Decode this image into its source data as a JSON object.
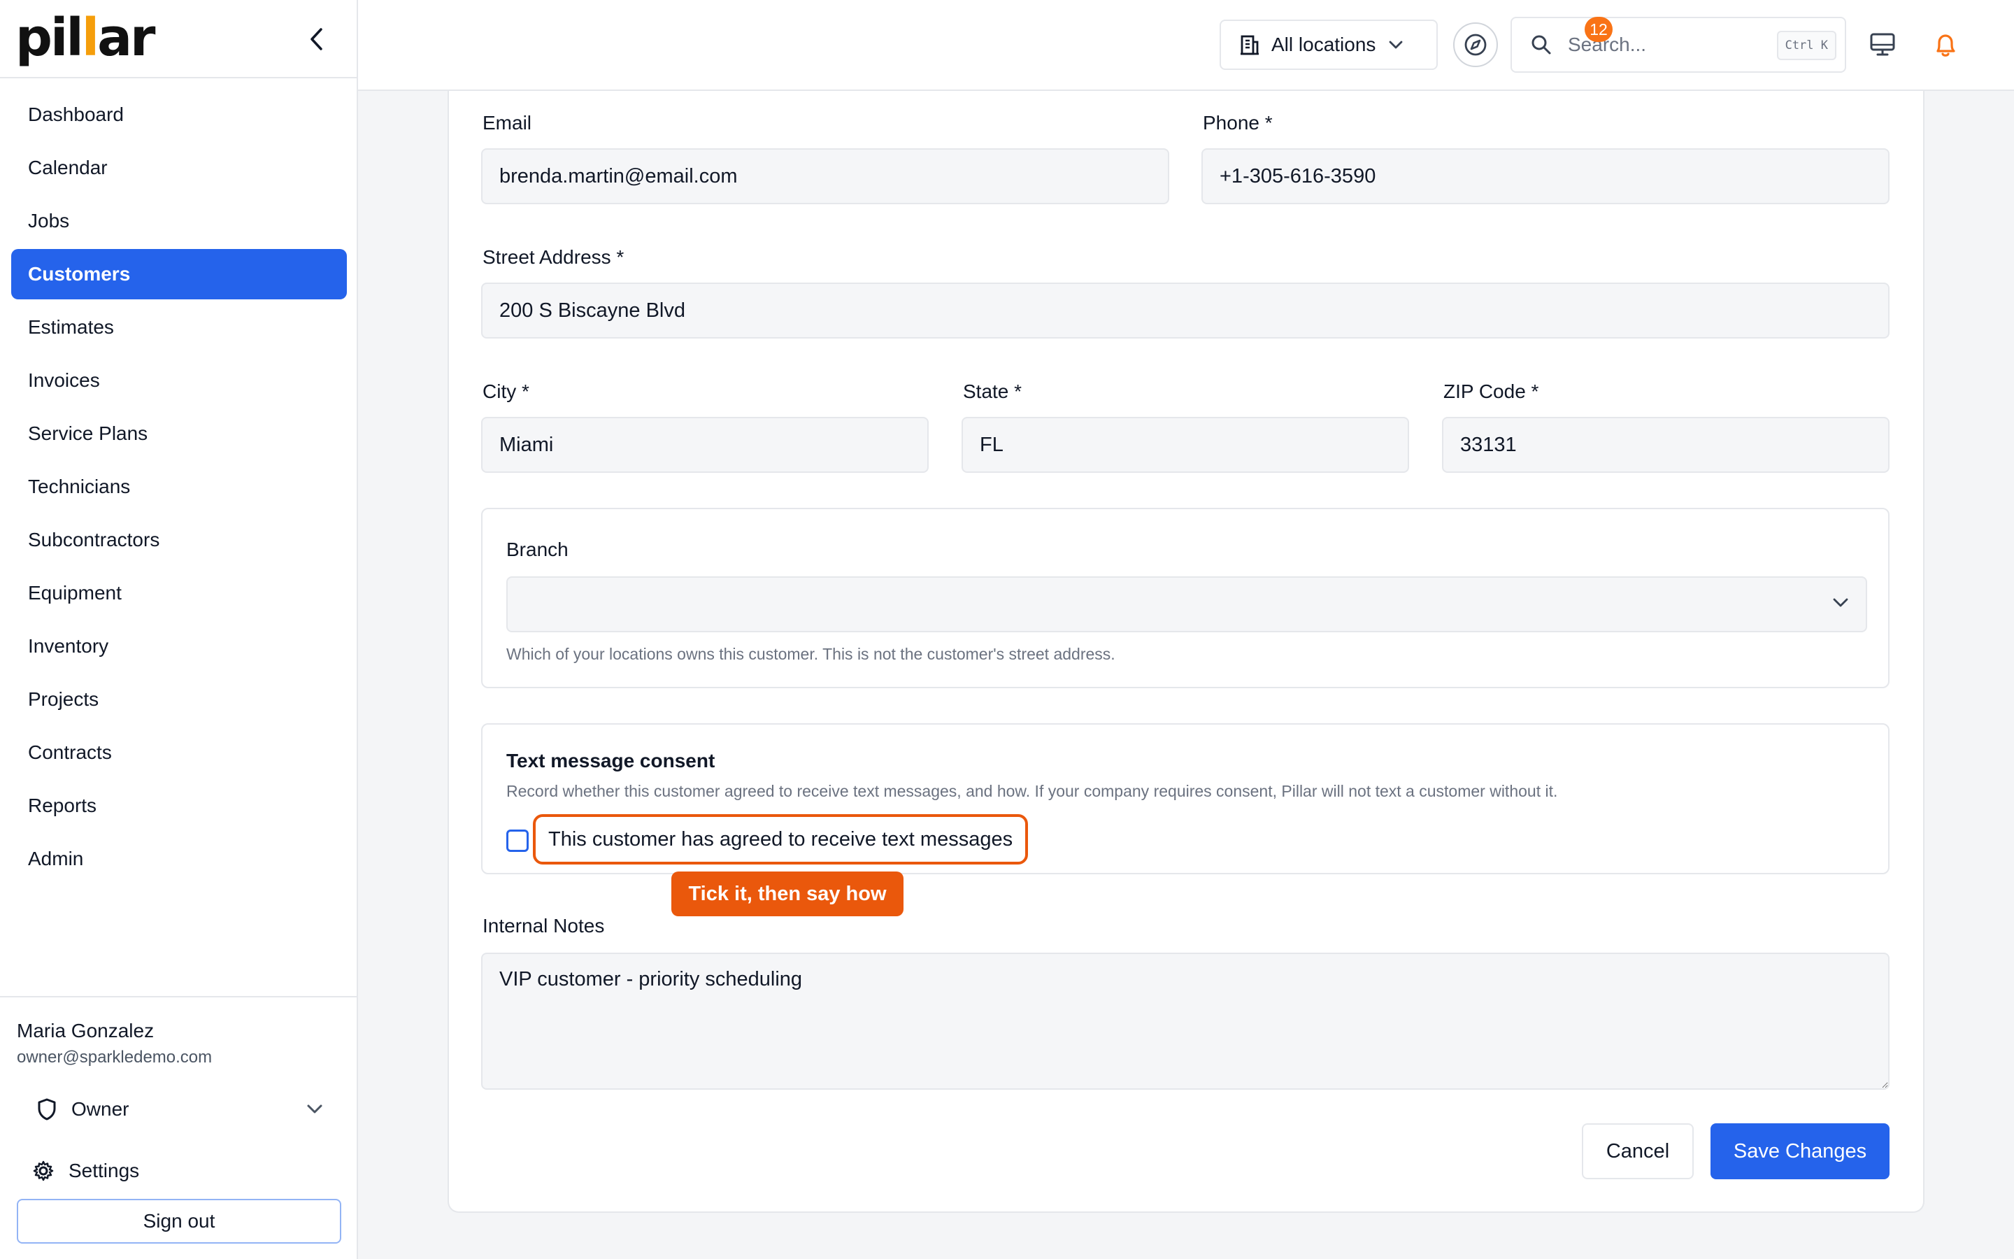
{
  "brand": {
    "logo_text_a": "pil",
    "logo_text_b": "l",
    "logo_text_c": "ar"
  },
  "nav": {
    "items": [
      {
        "label": "Dashboard",
        "active": false
      },
      {
        "label": "Calendar",
        "active": false
      },
      {
        "label": "Jobs",
        "active": false
      },
      {
        "label": "Customers",
        "active": true
      },
      {
        "label": "Estimates",
        "active": false
      },
      {
        "label": "Invoices",
        "active": false
      },
      {
        "label": "Service Plans",
        "active": false
      },
      {
        "label": "Technicians",
        "active": false
      },
      {
        "label": "Subcontractors",
        "active": false
      },
      {
        "label": "Equipment",
        "active": false
      },
      {
        "label": "Inventory",
        "active": false
      },
      {
        "label": "Projects",
        "active": false
      },
      {
        "label": "Contracts",
        "active": false
      },
      {
        "label": "Reports",
        "active": false
      },
      {
        "label": "Admin",
        "active": false
      }
    ]
  },
  "user": {
    "name": "Maria Gonzalez",
    "email": "owner@sparkledemo.com",
    "role": "Owner",
    "settings_label": "Settings",
    "signout_label": "Sign out"
  },
  "topbar": {
    "location_label": "All locations",
    "search_placeholder": "Search...",
    "search_shortcut": "Ctrl K",
    "notification_count": "12"
  },
  "form": {
    "email": {
      "label": "Email",
      "value": "brenda.martin@email.com"
    },
    "phone": {
      "label": "Phone *",
      "value": "+1-305-616-3590"
    },
    "street": {
      "label": "Street Address *",
      "value": "200 S Biscayne Blvd"
    },
    "city": {
      "label": "City *",
      "value": "Miami"
    },
    "state": {
      "label": "State *",
      "value": "FL"
    },
    "zip": {
      "label": "ZIP Code *",
      "value": "33131"
    },
    "branch": {
      "label": "Branch",
      "value": "",
      "help": "Which of your locations owns this customer. This is not the customer's street address."
    },
    "consent": {
      "title": "Text message consent",
      "help": "Record whether this customer agreed to receive text messages, and how. If your company requires consent, Pillar will not text a customer without it.",
      "checkbox_label": "This customer has agreed to receive text messages",
      "checked": false,
      "tooltip": "Tick it, then say how"
    },
    "notes": {
      "label": "Internal Notes",
      "value": "VIP customer - priority scheduling"
    },
    "cancel_label": "Cancel",
    "save_label": "Save Changes"
  },
  "colors": {
    "accent": "#2563eb",
    "highlight": "#ea580c",
    "badge": "#f97316",
    "logo_bar": "#f59e0b"
  }
}
